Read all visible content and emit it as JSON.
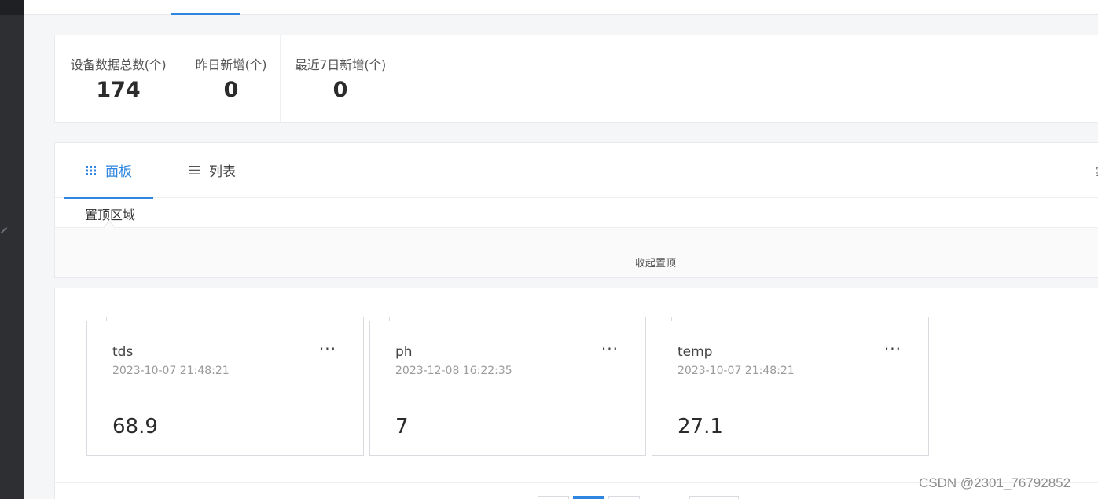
{
  "stats": [
    {
      "label": "设备数据总数(个)",
      "value": "174"
    },
    {
      "label": "昨日新增(个)",
      "value": "0"
    },
    {
      "label": "最近7日新增(个)",
      "value": "0"
    }
  ],
  "tabs": {
    "board": "面板",
    "list": "列表",
    "right_partial": "实"
  },
  "pinned": {
    "label": "置顶区域",
    "collapse": "收起置顶"
  },
  "cards": [
    {
      "name": "tds",
      "time": "2023-10-07 21:48:21",
      "value": "68.9"
    },
    {
      "name": "ph",
      "time": "2023-12-08 16:22:35",
      "value": "7"
    },
    {
      "name": "temp",
      "time": "2023-10-07 21:48:21",
      "value": "27.1"
    }
  ],
  "more_label": "···",
  "watermark": "CSDN @2301_76792852",
  "colors": {
    "accent": "#2f86e0",
    "sidebar": "#2d2f33"
  },
  "icons": {
    "board": "grid-icon",
    "list": "list-icon"
  }
}
